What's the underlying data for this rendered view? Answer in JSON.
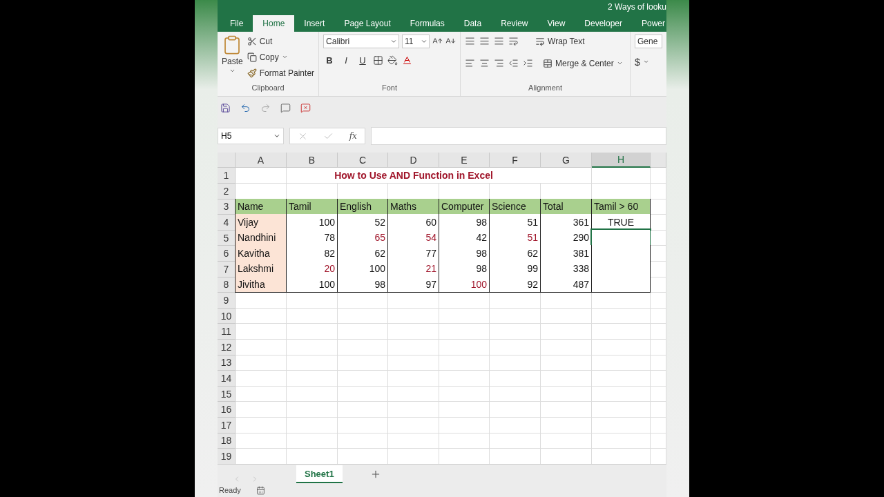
{
  "window": {
    "title": "2 Ways of looku"
  },
  "tabs": [
    {
      "label": "File",
      "selected": false
    },
    {
      "label": "Home",
      "selected": true
    },
    {
      "label": "Insert",
      "selected": false
    },
    {
      "label": "Page Layout",
      "selected": false
    },
    {
      "label": "Formulas",
      "selected": false
    },
    {
      "label": "Data",
      "selected": false
    },
    {
      "label": "Review",
      "selected": false
    },
    {
      "label": "View",
      "selected": false
    },
    {
      "label": "Developer",
      "selected": false
    },
    {
      "label": "Power",
      "selected": false
    }
  ],
  "ribbon": {
    "clipboard": {
      "label": "Clipboard",
      "paste": "Paste",
      "cut": "Cut",
      "copy": "Copy",
      "format_painter": "Format Painter"
    },
    "font": {
      "label": "Font",
      "font_name": "Calibri",
      "font_size": "11",
      "bold": "B",
      "italic": "I",
      "underline": "U"
    },
    "alignment": {
      "label": "Alignment",
      "wrap_text": "Wrap Text",
      "merge_center": "Merge & Center"
    },
    "number": {
      "format": "Gene",
      "currency": "$"
    }
  },
  "formula_bar": {
    "name_box": "H5",
    "fx": "fx"
  },
  "sheet": {
    "columns": [
      {
        "label": "A",
        "selected": false
      },
      {
        "label": "B",
        "selected": false
      },
      {
        "label": "C",
        "selected": false
      },
      {
        "label": "D",
        "selected": false
      },
      {
        "label": "E",
        "selected": false
      },
      {
        "label": "F",
        "selected": false
      },
      {
        "label": "G",
        "selected": false
      },
      {
        "label": "H",
        "selected": true
      }
    ],
    "rows": [
      {
        "label": "1",
        "kind": "title",
        "title": "How to Use AND Function in Excel"
      },
      {
        "label": "2",
        "kind": "empty"
      },
      {
        "label": "3",
        "kind": "header",
        "cells": [
          "Name",
          "Tamil",
          "English",
          "Maths",
          "Computer",
          "Science",
          "Total",
          "Tamil > 60"
        ]
      },
      {
        "label": "4",
        "kind": "data",
        "name": "Vijay",
        "values": [
          {
            "text": "100",
            "flagged": false
          },
          {
            "text": "52",
            "flagged": false
          },
          {
            "text": "60",
            "flagged": false
          },
          {
            "text": "98",
            "flagged": false
          },
          {
            "text": "51",
            "flagged": false
          },
          {
            "text": "361",
            "flagged": false
          }
        ],
        "result": "TRUE",
        "selected": false
      },
      {
        "label": "5",
        "kind": "data",
        "name": "Nandhini",
        "values": [
          {
            "text": "78",
            "flagged": false
          },
          {
            "text": "65",
            "flagged": true
          },
          {
            "text": "54",
            "flagged": true
          },
          {
            "text": "42",
            "flagged": false
          },
          {
            "text": "51",
            "flagged": true
          },
          {
            "text": "290",
            "flagged": false
          }
        ],
        "selected": true
      },
      {
        "label": "6",
        "kind": "data",
        "name": "Kavitha",
        "values": [
          {
            "text": "82",
            "flagged": false
          },
          {
            "text": "62",
            "flagged": false
          },
          {
            "text": "77",
            "flagged": false
          },
          {
            "text": "98",
            "flagged": false
          },
          {
            "text": "62",
            "flagged": false
          },
          {
            "text": "381",
            "flagged": false
          }
        ],
        "selected": false
      },
      {
        "label": "7",
        "kind": "data",
        "name": "Lakshmi",
        "values": [
          {
            "text": "20",
            "flagged": true
          },
          {
            "text": "100",
            "flagged": false
          },
          {
            "text": "21",
            "flagged": true
          },
          {
            "text": "98",
            "flagged": false
          },
          {
            "text": "99",
            "flagged": false
          },
          {
            "text": "338",
            "flagged": false
          }
        ],
        "selected": false
      },
      {
        "label": "8",
        "kind": "data",
        "name": "Jivitha",
        "values": [
          {
            "text": "100",
            "flagged": false
          },
          {
            "text": "98",
            "flagged": false
          },
          {
            "text": "97",
            "flagged": false
          },
          {
            "text": "100",
            "flagged": true
          },
          {
            "text": "92",
            "flagged": false
          },
          {
            "text": "487",
            "flagged": false
          }
        ],
        "selected": false
      },
      {
        "label": "9",
        "kind": "empty"
      },
      {
        "label": "10",
        "kind": "empty"
      },
      {
        "label": "11",
        "kind": "empty"
      },
      {
        "label": "12",
        "kind": "empty"
      },
      {
        "label": "13",
        "kind": "empty"
      },
      {
        "label": "14",
        "kind": "empty"
      },
      {
        "label": "15",
        "kind": "empty"
      },
      {
        "label": "16",
        "kind": "empty"
      },
      {
        "label": "17",
        "kind": "empty"
      },
      {
        "label": "18",
        "kind": "empty"
      },
      {
        "label": "19",
        "kind": "empty"
      }
    ]
  },
  "sheet_tabs": [
    {
      "label": "Sheet1",
      "selected": true
    }
  ],
  "status_bar": {
    "status": "Ready"
  }
}
